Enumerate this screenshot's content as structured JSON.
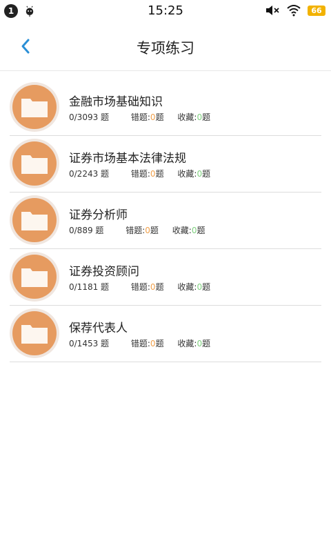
{
  "status_bar": {
    "notification_count": "1",
    "time": "15:25",
    "battery": "66"
  },
  "nav": {
    "title": "专项练习"
  },
  "items": [
    {
      "title": "金融市场基础知识",
      "progress": "0/3093 题",
      "wrong_label": "错题:",
      "wrong_count": "0",
      "wrong_unit": "题",
      "fav_label": "收藏:",
      "fav_count": "0",
      "fav_unit": "题"
    },
    {
      "title": "证券市场基本法律法规",
      "progress": "0/2243 题",
      "wrong_label": "错题:",
      "wrong_count": "0",
      "wrong_unit": "题",
      "fav_label": "收藏:",
      "fav_count": "0",
      "fav_unit": "题"
    },
    {
      "title": "证券分析师",
      "progress": "0/889 题",
      "wrong_label": "错题:",
      "wrong_count": "0",
      "wrong_unit": "题",
      "fav_label": "收藏:",
      "fav_count": "0",
      "fav_unit": "题"
    },
    {
      "title": "证券投资顾问",
      "progress": "0/1181 题",
      "wrong_label": "错题:",
      "wrong_count": "0",
      "wrong_unit": "题",
      "fav_label": "收藏:",
      "fav_count": "0",
      "fav_unit": "题"
    },
    {
      "title": "保荐代表人",
      "progress": "0/1453 题",
      "wrong_label": "错题:",
      "wrong_count": "0",
      "wrong_unit": "题",
      "fav_label": "收藏:",
      "fav_count": "0",
      "fav_unit": "题"
    }
  ],
  "icons": {
    "back": "chevron-left-icon",
    "folder": "folder-icon",
    "mute": "volume-mute-icon",
    "wifi": "wifi-icon",
    "battery": "battery-icon",
    "android": "android-icon"
  },
  "colors": {
    "accent": "#2a8fd6",
    "folder_bg": "#e69b60",
    "wrong_count": "#f0a04b",
    "fav_count": "#7fd07f"
  }
}
